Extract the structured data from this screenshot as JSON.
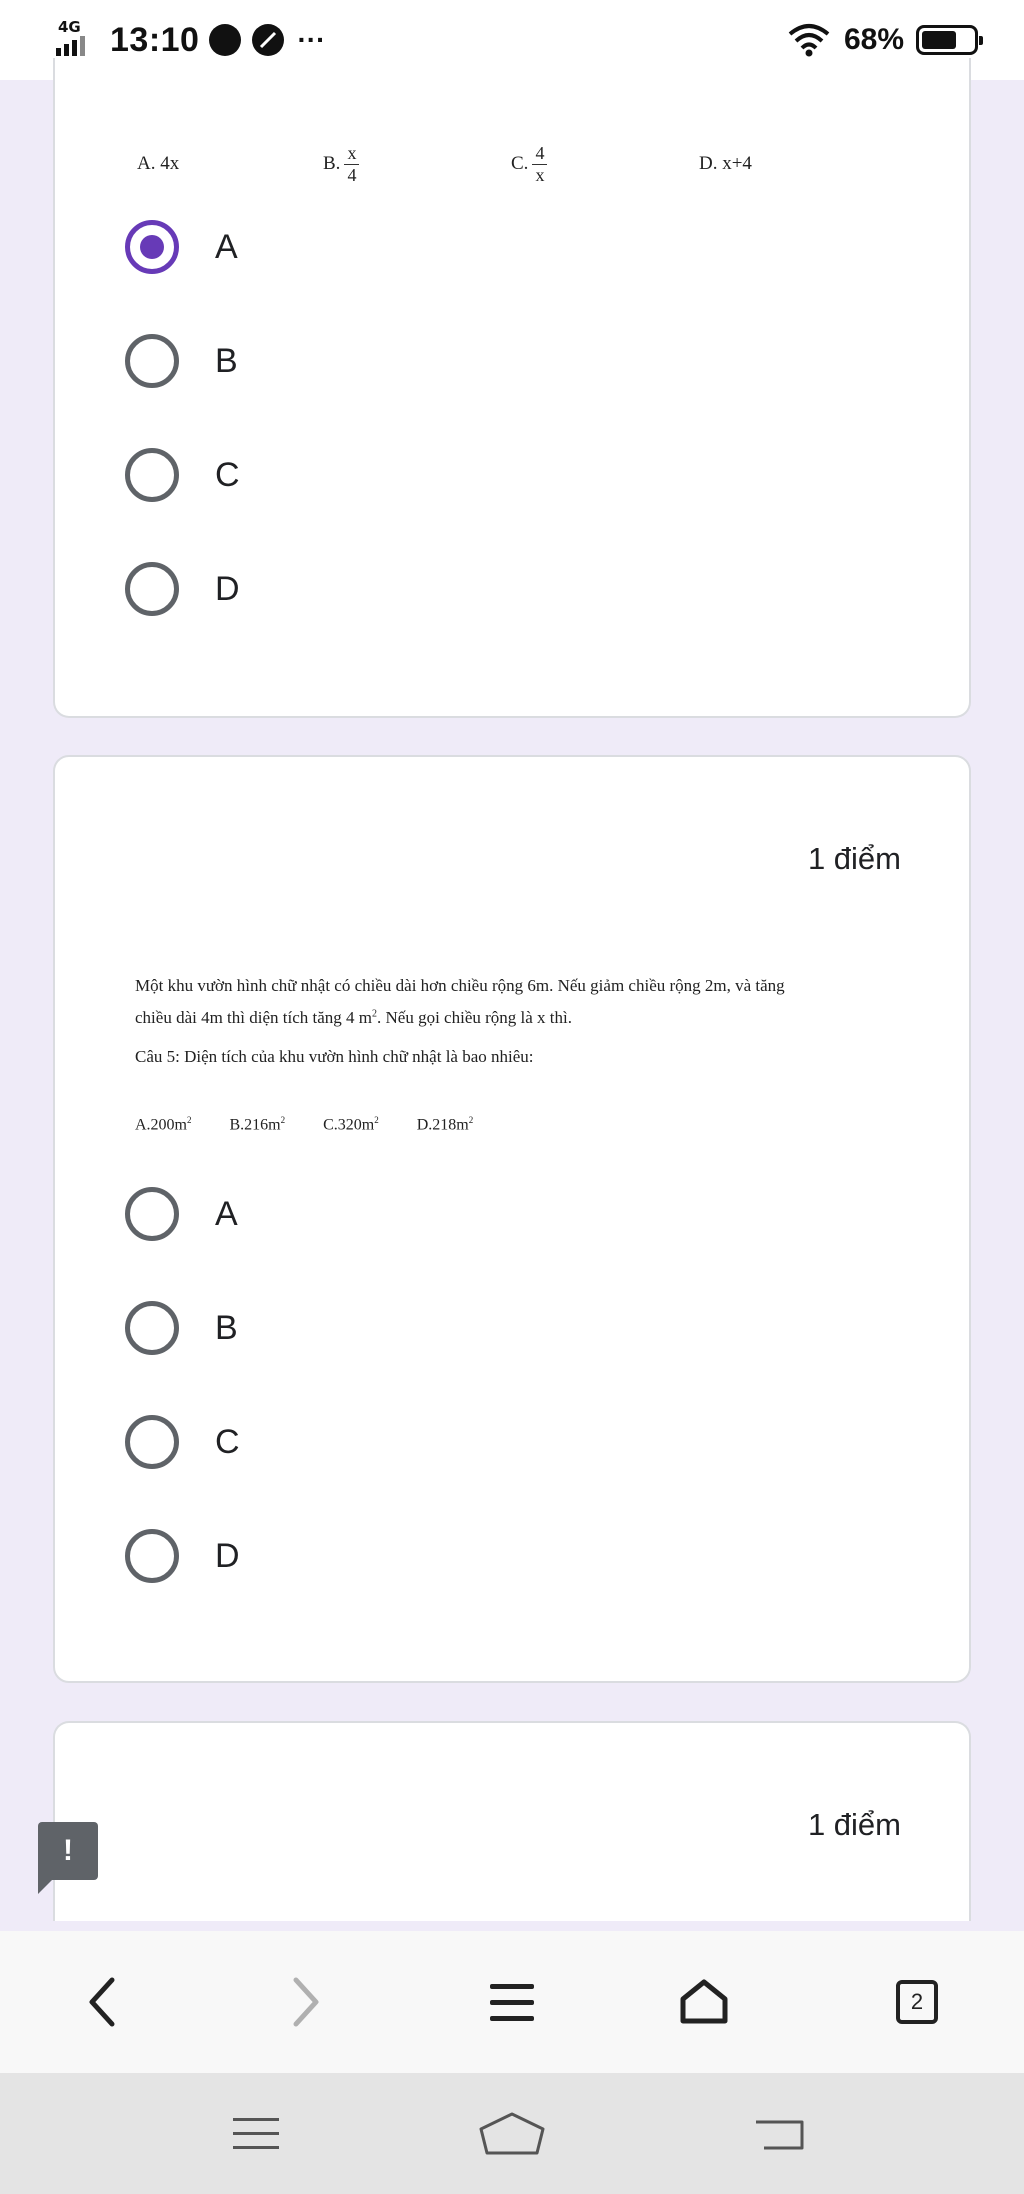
{
  "status_bar": {
    "network": "4G",
    "time": "13:10",
    "more": "···",
    "battery_percent": "68%",
    "battery_level": 0.68
  },
  "question4": {
    "answers": {
      "a": "A. 4x",
      "b_prefix": "B.",
      "b_num": "x",
      "b_den": "4",
      "c_prefix": "C.",
      "c_num": "4",
      "c_den": "x",
      "d": "D. x+4"
    },
    "options": [
      "A",
      "B",
      "C",
      "D"
    ],
    "selected": "A"
  },
  "question5": {
    "points": "1 điểm",
    "line1": "Một khu vườn hình chữ nhật có chiều dài hơn chiều rộng 6m. Nếu giảm chiều rộng 2m, và tăng",
    "line2_prefix": "chiều dài 4m thì diện tích tăng 4 m",
    "line2_sup": "2",
    "line2_suffix": ". Nếu gọi chiều rộng là x thì.",
    "line3": "Câu 5: Diện tích của khu vườn hình chữ nhật là bao nhiêu:",
    "answers": [
      {
        "text": "A.200m",
        "sup": "2"
      },
      {
        "text": "B.216m",
        "sup": "2"
      },
      {
        "text": "C.320m",
        "sup": "2"
      },
      {
        "text": "D.218m",
        "sup": "2"
      }
    ],
    "options": [
      "A",
      "B",
      "C",
      "D"
    ]
  },
  "question6": {
    "points": "1 điểm"
  },
  "feedback_icon": "!",
  "browser_bar": {
    "tab_count": "2"
  },
  "colors": {
    "accent": "#673ab7",
    "background": "#efebf8",
    "radio_gray": "#5f6368"
  }
}
